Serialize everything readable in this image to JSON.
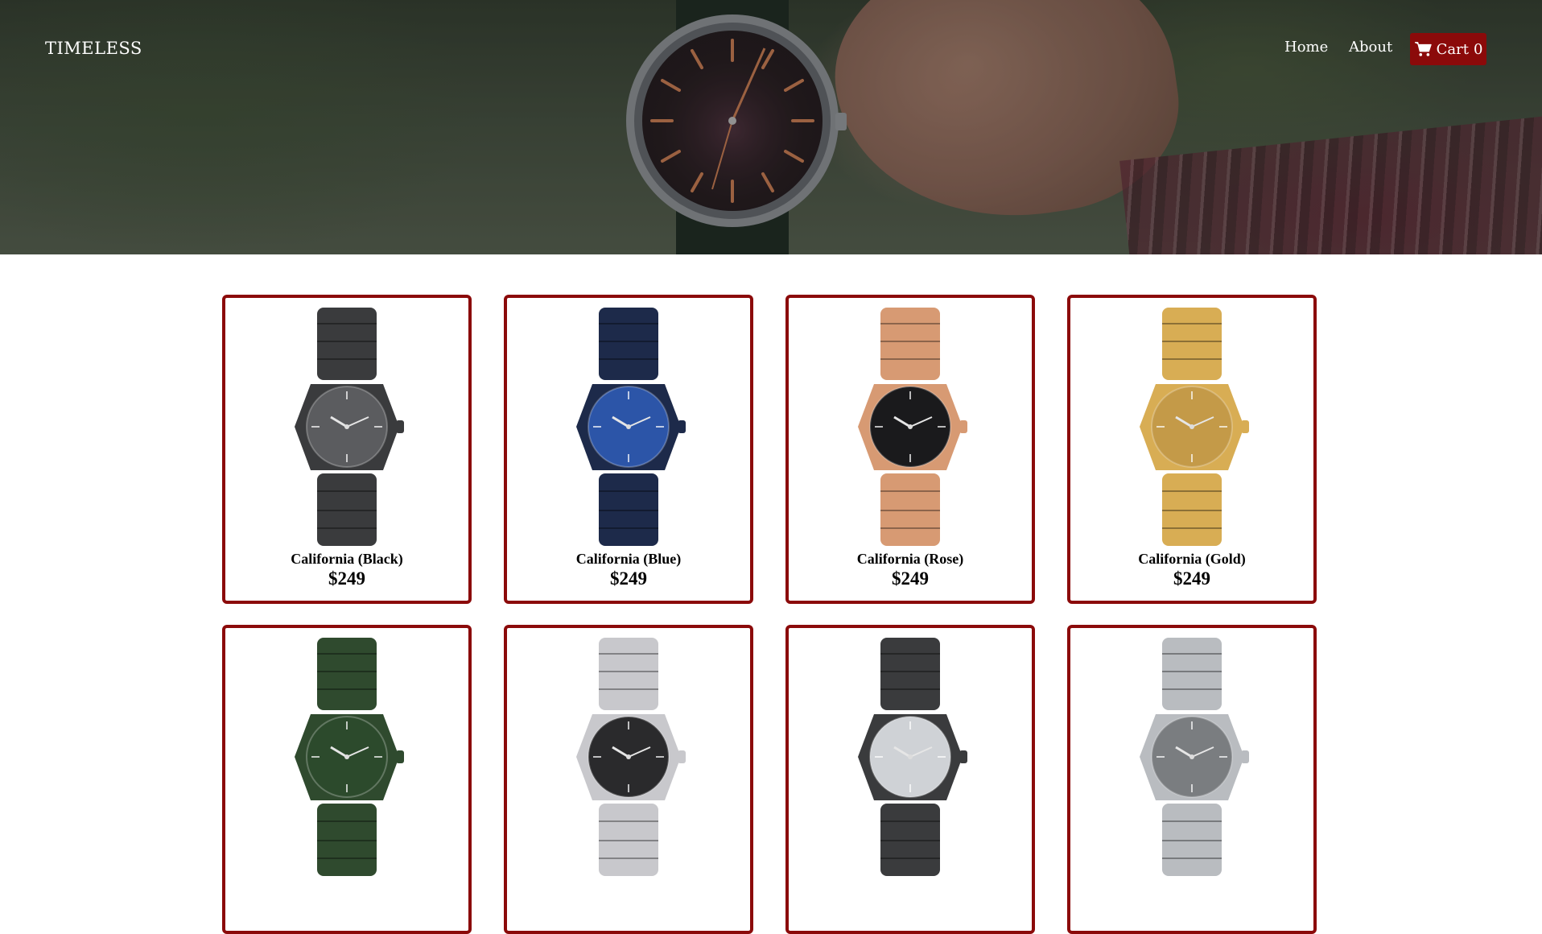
{
  "nav": {
    "brand": "TIMELESS",
    "links": [
      {
        "label": "Home"
      },
      {
        "label": "About"
      }
    ],
    "cart_label": "Cart",
    "cart_count": "0"
  },
  "colors": {
    "accent": "#8b0a0a"
  },
  "products": [
    {
      "name": "California (Black)",
      "price": "$249",
      "case": "#3a3b3d",
      "dial": "#5b5c5f"
    },
    {
      "name": "California (Blue)",
      "price": "$249",
      "case": "#1d2a4a",
      "dial": "#2c55a8"
    },
    {
      "name": "California (Rose)",
      "price": "$249",
      "case": "#d79a73",
      "dial": "#1a1a1c"
    },
    {
      "name": "California (Gold)",
      "price": "$249",
      "case": "#d8ad54",
      "dial": "#c49a48"
    },
    {
      "name": "",
      "price": "",
      "case": "#2f4a2e",
      "dial": "#2c4a2c"
    },
    {
      "name": "",
      "price": "",
      "case": "#c8c8cc",
      "dial": "#2a2a2c"
    },
    {
      "name": "",
      "price": "",
      "case": "#3a3b3d",
      "dial": "#cfd2d6"
    },
    {
      "name": "",
      "price": "",
      "case": "#b9bcc0",
      "dial": "#7a7d80"
    }
  ]
}
